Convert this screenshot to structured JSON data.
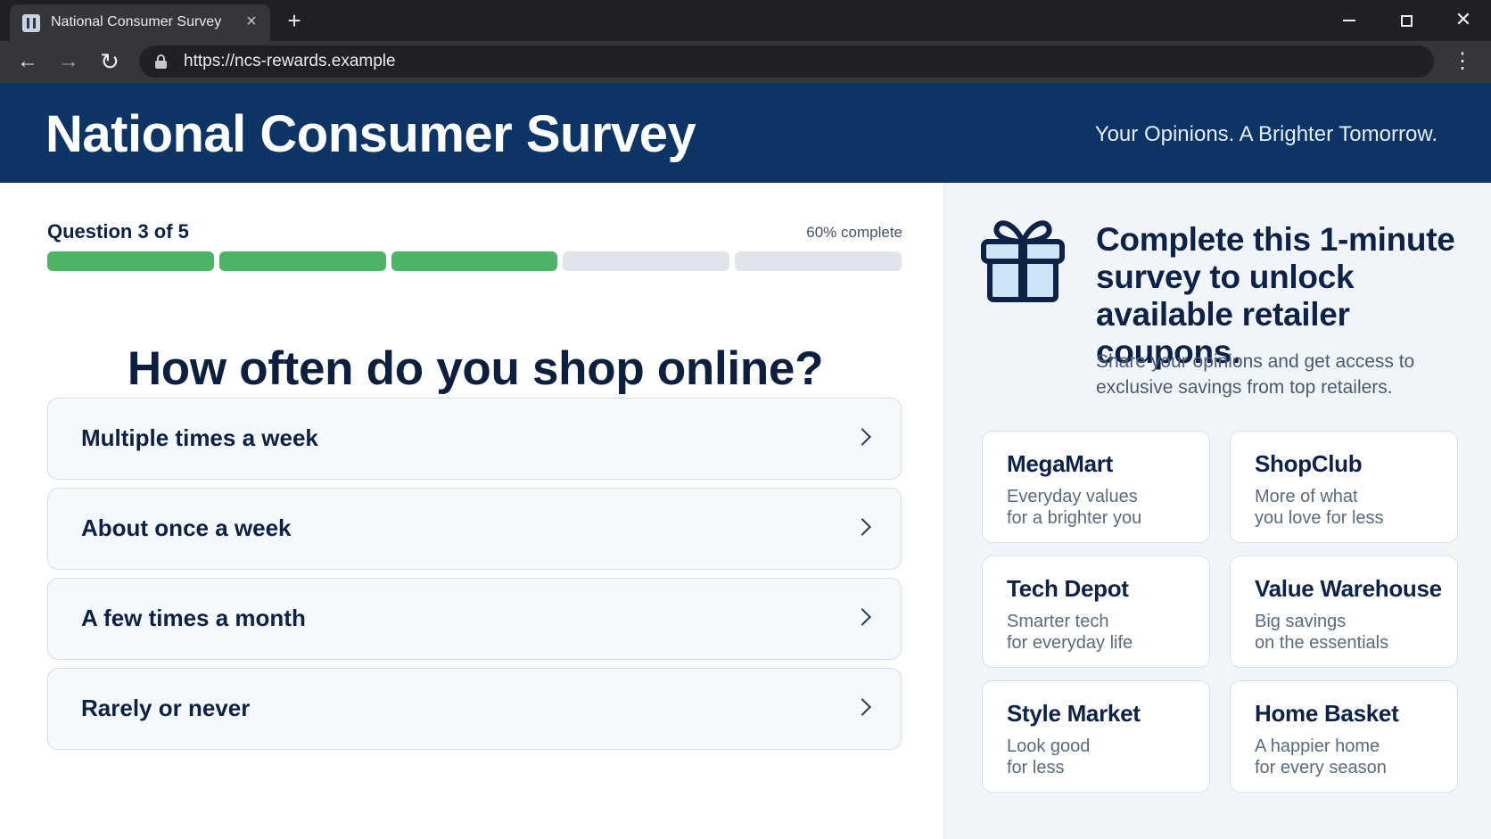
{
  "browser": {
    "tab_title": "National Consumer Survey",
    "url": "https://ncs-rewards.example"
  },
  "header": {
    "title": "National Consumer Survey",
    "tagline": "Your Opinions. A Brighter Tomorrow."
  },
  "survey": {
    "question_counter": "Question 3 of 5",
    "completion_text": "60% complete",
    "progress": {
      "completed_steps": 3,
      "total_steps": 5
    },
    "question": "How often do you shop online?",
    "options": [
      {
        "label": "Multiple times a week"
      },
      {
        "label": "About once a week"
      },
      {
        "label": "A few times a month"
      },
      {
        "label": "Rarely or never"
      }
    ]
  },
  "rewards": {
    "icon": "gift-icon",
    "title": "Complete this 1-minute survey to unlock available retailer coupons.",
    "subtitle": "Share your opinions and get access to exclusive savings from top retailers.",
    "retailers": [
      {
        "name": "MegaMart",
        "line1": "Everyday values",
        "line2": "for a brighter you"
      },
      {
        "name": "ShopClub",
        "line1": "More of what",
        "line2": "you love for less"
      },
      {
        "name": "Tech Depot",
        "line1": "Smarter tech",
        "line2": "for everyday life"
      },
      {
        "name": "Value Warehouse",
        "line1": "Big savings",
        "line2": "on the essentials"
      },
      {
        "name": "Style Market",
        "line1": "Look good",
        "line2": "for less"
      },
      {
        "name": "Home Basket",
        "line1": "A happier home",
        "line2": "for every season"
      }
    ]
  },
  "colors": {
    "header_bg": "#0c3565",
    "progress_done": "#4cb464",
    "progress_todo": "#e1e5eb",
    "text_primary": "#0c1f3f"
  }
}
